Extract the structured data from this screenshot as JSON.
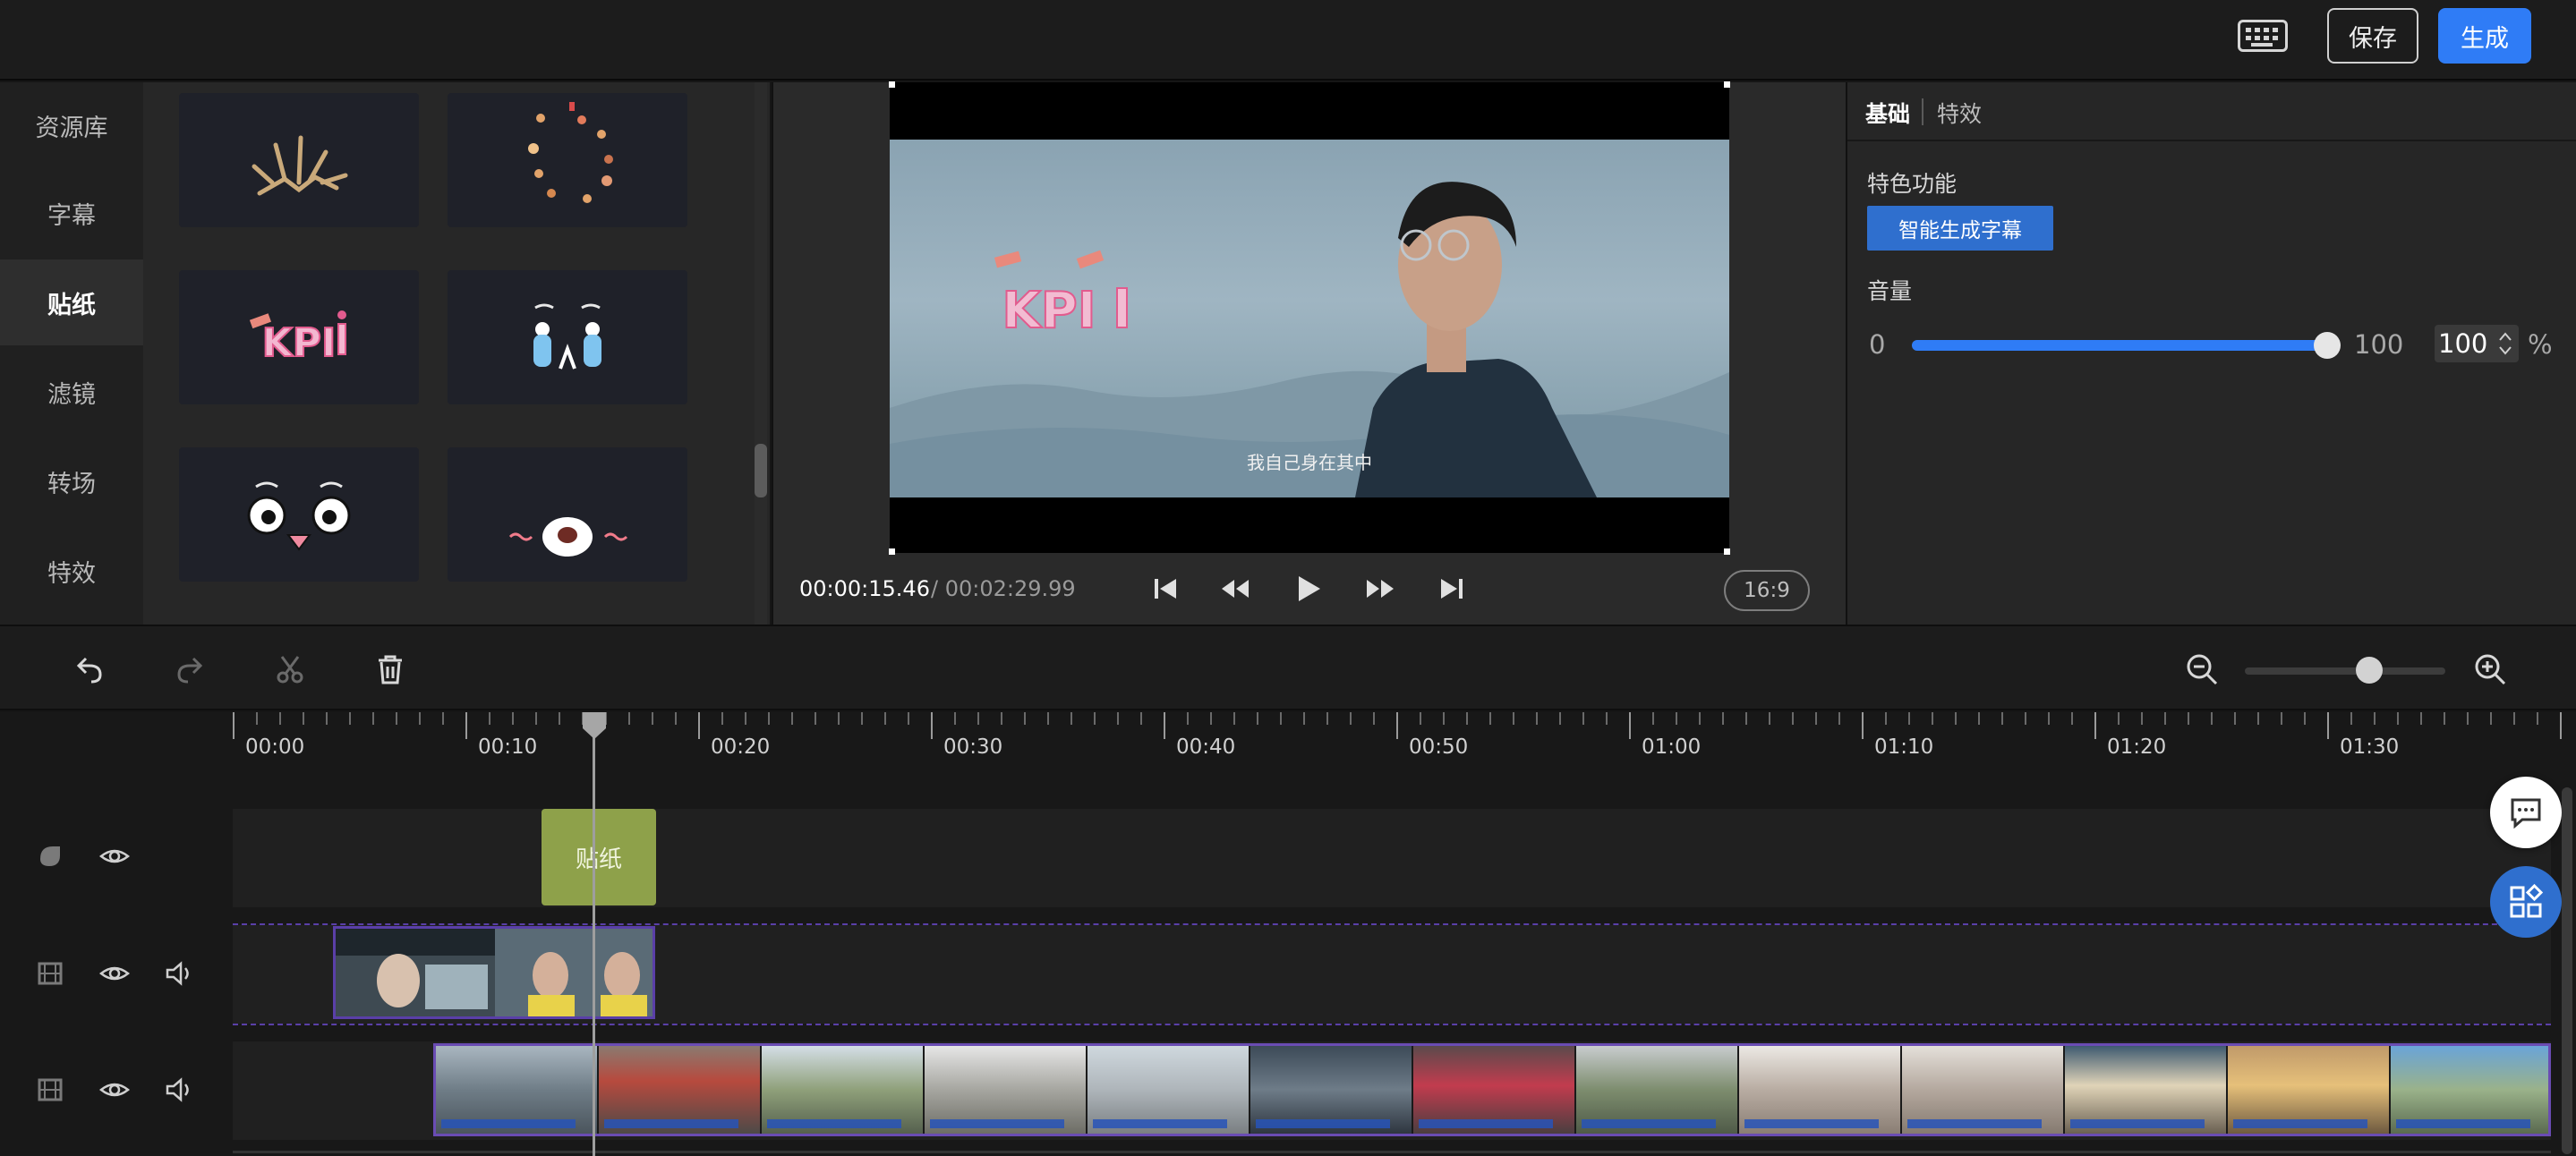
{
  "topbar": {
    "keyboard_icon": "keyboard-icon",
    "save_label": "保存",
    "generate_label": "生成",
    "accent_color": "#2f7cf6"
  },
  "leftnav": {
    "items": [
      {
        "label": "资源库",
        "active": false
      },
      {
        "label": "字幕",
        "active": false
      },
      {
        "label": "贴纸",
        "active": true
      },
      {
        "label": "滤镜",
        "active": false
      },
      {
        "label": "转场",
        "active": false
      },
      {
        "label": "特效",
        "active": false
      }
    ]
  },
  "preview": {
    "sticker_text": "KPI",
    "subtitle": "我自己身在其中",
    "time_current": "00:00:15.46",
    "time_total": "/ 00:02:29.99",
    "aspect_ratio": "16:9"
  },
  "props": {
    "tabs": [
      {
        "label": "基础",
        "active": true
      },
      {
        "label": "特效",
        "active": false
      }
    ],
    "feature_label": "特色功能",
    "ai_subtitle_button": "智能生成字幕",
    "volume_label": "音量",
    "volume_min": "0",
    "volume_max": "100",
    "volume_value": "100",
    "volume_unit": "%",
    "volume_fraction": 1.0
  },
  "timeline": {
    "zoom_fraction": 0.62,
    "ruler_labels": [
      "00:00",
      "00:10",
      "00:20",
      "00:30",
      "00:40",
      "00:50",
      "01:00",
      "01:10",
      "01:20",
      "01:30"
    ],
    "sticker_clip_label": "贴纸",
    "playhead_time_seconds": 15.46
  }
}
